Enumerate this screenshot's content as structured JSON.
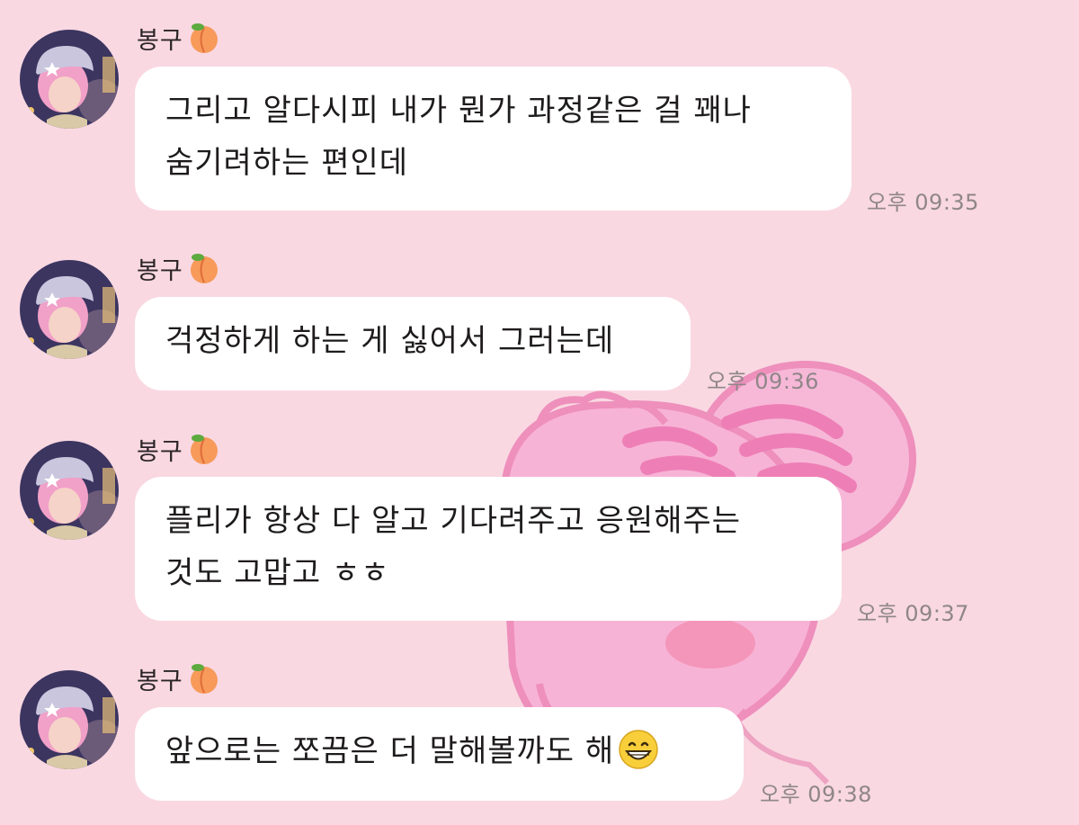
{
  "chat": {
    "messages": [
      {
        "sender": "봉구",
        "sender_icon": "peach-icon",
        "lines": [
          "그리고 알다시피 내가 뭔가 과정같은 걸 꽤나",
          "숨기려하는 편인데"
        ],
        "time": "오후 09:35"
      },
      {
        "sender": "봉구",
        "sender_icon": "peach-icon",
        "lines": [
          "걱정하게 하는 게 싫어서 그러는데"
        ],
        "time": "오후 09:36"
      },
      {
        "sender": "봉구",
        "sender_icon": "peach-icon",
        "lines": [
          "플리가 항상 다 알고 기다려주고 응원해주는",
          "것도 고맙고 ㅎㅎ"
        ],
        "time": "오후 09:37"
      },
      {
        "sender": "봉구",
        "sender_icon": "peach-icon",
        "lines": [
          "앞으로는 쪼끔은 더 말해볼까도 해"
        ],
        "trailing_icon": "grinning-face-icon",
        "time": "오후 09:38"
      }
    ]
  },
  "colors": {
    "background": "#f9d8e2",
    "bubble": "#ffffff",
    "timestamp": "#8f8688",
    "wallpaper_character": "#f4a6cf"
  }
}
